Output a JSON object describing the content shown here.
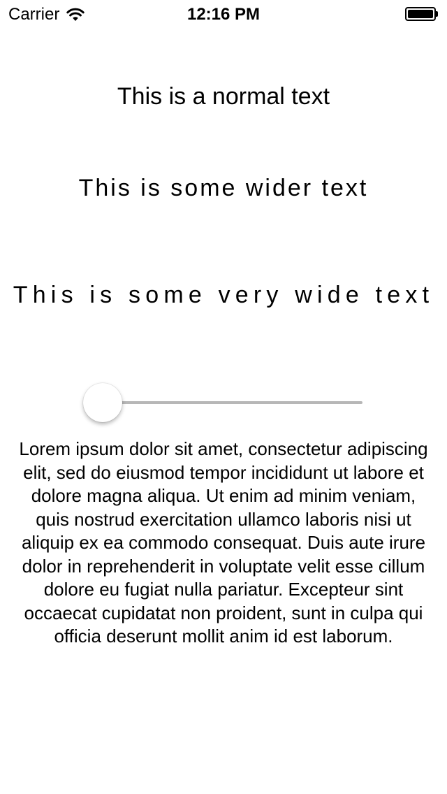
{
  "status_bar": {
    "carrier": "Carrier",
    "time": "12:16 PM",
    "wifi_icon": "wifi-icon",
    "battery_icon": "battery-full-icon"
  },
  "texts": {
    "normal": "This is a normal text",
    "wider": "This is some wider text",
    "very_wide": "This is some very wide text"
  },
  "slider": {
    "value": 0
  },
  "paragraph": "Lorem ipsum dolor sit amet, consectetur adipiscing elit, sed do eiusmod tempor incididunt ut labore et dolore magna aliqua. Ut enim ad minim veniam, quis nostrud exercitation ullamco laboris nisi ut aliquip ex ea commodo consequat. Duis aute irure dolor in reprehenderit in voluptate velit esse cillum dolore eu fugiat nulla pariatur. Excepteur sint occaecat cupidatat non proident, sunt in culpa qui officia deserunt mollit anim id est laborum.",
  "colors": {
    "text": "#000000",
    "background": "#ffffff",
    "slider_track": "#b7b7b7"
  }
}
